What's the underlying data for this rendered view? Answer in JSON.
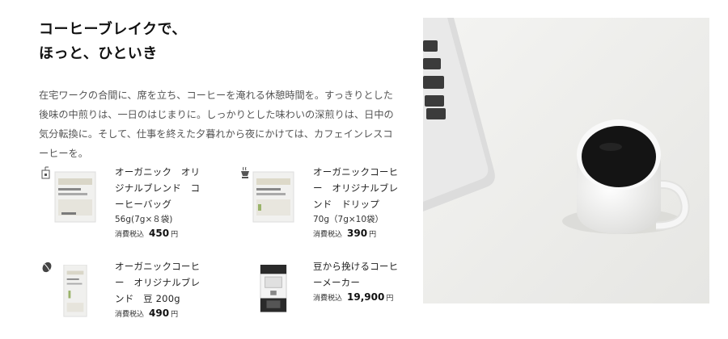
{
  "heading": {
    "line1": "コーヒーブレイクで、",
    "line2": "ほっと、ひといき"
  },
  "intro": "在宅ワークの合間に、席を立ち、コーヒーを淹れる休憩時間を。すっきりとした後味の中煎りは、一日のはじまりに。しっかりとした味わいの深煎りは、日中の気分転換に。そして、仕事を終えた夕暮れから夜にかけては、カフェインレスコーヒーを。",
  "products": [
    {
      "icon": "coffee-bag-icon",
      "name": "オーガニック　オリジナルブレンド　コーヒーバッグ",
      "spec": "56g(7g×８袋)",
      "tax_label": "消費税込",
      "price": "450",
      "yen": "円"
    },
    {
      "icon": "drip-coffee-icon",
      "name": "オーガニックコーヒー　オリジナルブレンド　ドリップ",
      "spec": "70g（7g×10袋）",
      "tax_label": "消費税込",
      "price": "390",
      "yen": "円"
    },
    {
      "icon": "coffee-bean-icon",
      "name": "オーガニックコーヒー　オリジナルブレンド　豆 200g",
      "spec": "",
      "tax_label": "消費税込",
      "price": "490",
      "yen": "円"
    },
    {
      "icon": "",
      "name": "豆から挽けるコーヒーメーカー",
      "spec": "",
      "tax_label": "消費税込",
      "price": "19,900",
      "yen": "円"
    }
  ],
  "colors": {
    "text": "#222222",
    "body_text": "#555555",
    "photo_bg": "#eeeeec",
    "coffee": "#141414"
  }
}
